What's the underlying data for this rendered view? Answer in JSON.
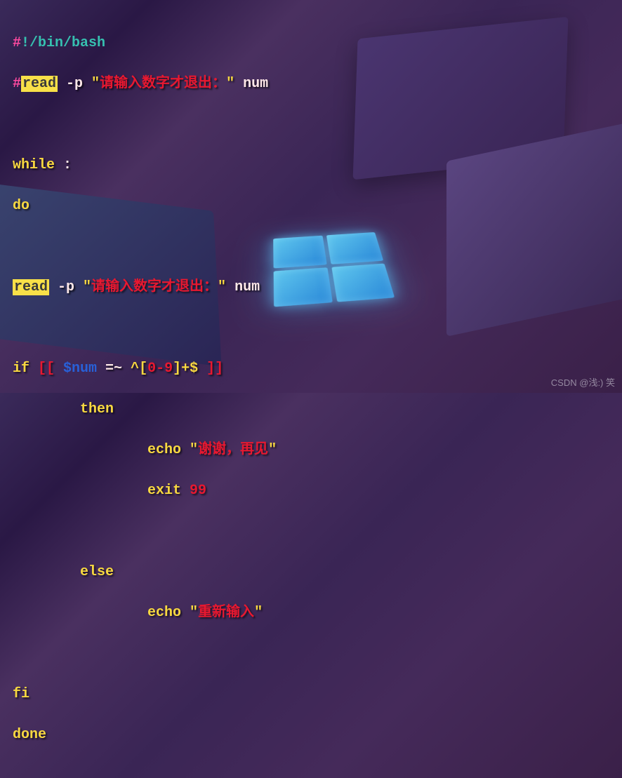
{
  "code": {
    "l1_hash": "#",
    "l1_bang": "!",
    "l1_path": "/bin/bash",
    "l2_hash": "#",
    "l2_read": "read",
    "l2_flag": " -p ",
    "l2_q1": "\"",
    "l2_prompt": "请输入数字才退出：",
    "l2_q2": "\" ",
    "l2_var": "num",
    "l4_while": "while",
    "l4_colon": " :",
    "l5_do": "do",
    "l7_read": "read",
    "l7_flag": " -p ",
    "l7_q1": "\"",
    "l7_prompt": "请输入数字才退出：",
    "l7_q2": "\" ",
    "l7_var": "num",
    "l9_if": "if",
    "l9_bb1": " [[ ",
    "l9_var": "$num",
    "l9_op": " =~ ",
    "l9_reg1": "^[",
    "l9_range": "0-9",
    "l9_reg2": "]+$",
    "l9_bb2": " ]]",
    "l10_then": "        then",
    "l11_echo": "                echo ",
    "l11_q1": "\"",
    "l11_msg": "谢谢，再见",
    "l11_q2": "\"",
    "l12_exit": "                exit ",
    "l12_code": "99",
    "l14_else": "        else",
    "l15_echo": "                echo ",
    "l15_q1": "\"",
    "l15_msg": "重新输入",
    "l15_q2": "\"",
    "l17_fi": "fi",
    "l18_done": "done"
  },
  "watermark": "CSDN @浅:) 笑"
}
